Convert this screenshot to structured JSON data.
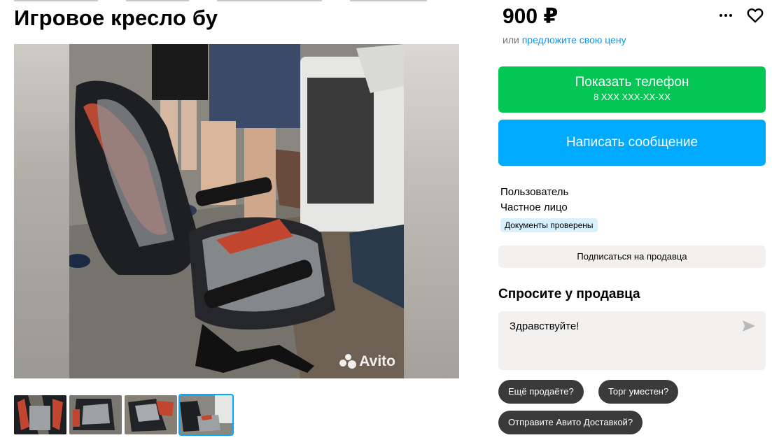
{
  "listing": {
    "title": "Игровое кресло бу",
    "price": "900 ₽",
    "offer_prefix": "или",
    "offer_link": "предложите свою цену",
    "watermark": "Avito"
  },
  "actions": {
    "phone_label": "Показать телефон",
    "phone_masked": "8 XXX XXX-XX-XX",
    "message_label": "Написать сообщение",
    "subscribe_label": "Подписаться на продавца"
  },
  "seller": {
    "name": "Пользователь",
    "type": "Частное лицо",
    "badge": "Документы проверены"
  },
  "ask": {
    "title": "Спросите у продавца",
    "message": "Здравствуйте!",
    "chips": [
      "Ещё продаёте?",
      "Торг уместен?",
      "Отправите Авито Доставкой?"
    ]
  },
  "colors": {
    "green": "#04c654",
    "blue": "#00aaff",
    "link": "#0099f7",
    "badge_bg": "#d9f0ff",
    "chip_bg": "#3a3a3a"
  },
  "icons": [
    "more-icon",
    "heart-icon",
    "send-icon",
    "avito-logo"
  ]
}
